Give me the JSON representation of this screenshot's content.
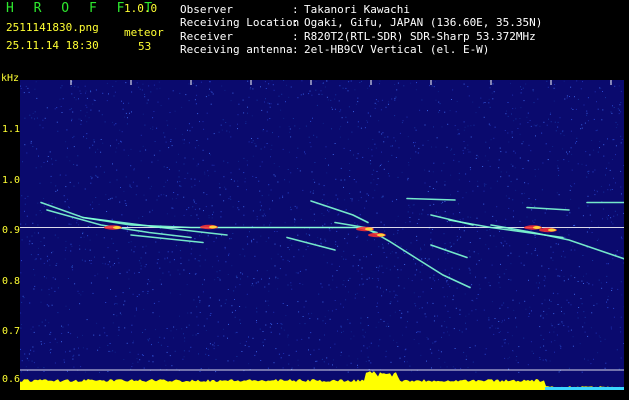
{
  "header": {
    "app_title": "H R O F F T",
    "app_version": "1.0.0",
    "file_name": "2511141830.png",
    "timestamp": "25.11.14 18:30",
    "meteor_label": "meteor",
    "meteor_count": "53",
    "info": [
      {
        "label": "Observer",
        "value": "Takanori Kawachi"
      },
      {
        "label": "Receiving Location",
        "value": "Ogaki, Gifu, JAPAN (136.60E, 35.35N)"
      },
      {
        "label": "Receiver",
        "value": "R820T2(RTL-SDR) SDR-Sharp 53.372MHz"
      },
      {
        "label": "Receiving antenna",
        "value": "2el-HB9CV Vertical (el. E-W)"
      }
    ],
    "separator": ":"
  },
  "colors": {
    "background": "#000000",
    "plot_background": "#0a0a6e",
    "title": "#2ee82e",
    "axis_text": "#ffff33",
    "trail": "#7fffd4",
    "reference_line": "#ffffff",
    "bottom_band": "#ffff00"
  },
  "chart_data": {
    "type": "heatmap",
    "yunit": "kHz",
    "yticks": [
      "1.1",
      "1.0",
      "0.9",
      "0.8",
      "0.7",
      "0.6"
    ],
    "xticks": [
      "1831",
      "1832",
      "1833",
      "1834",
      "1835",
      "1836",
      "1837",
      "1838",
      "1839",
      "1840"
    ],
    "xlim": [
      1830.5,
      1840.5
    ],
    "ylim": [
      0.58,
      1.15
    ],
    "reference_lines": [
      0.905,
      0.62
    ],
    "traces": [
      {
        "x": [
          1830.5,
          1831.2,
          1832.0,
          1833.0,
          1834.0,
          1835.0,
          1835.8,
          1836.1
        ],
        "y": [
          0.955,
          0.925,
          0.91,
          0.905,
          0.905,
          0.905,
          0.905,
          0.895
        ]
      },
      {
        "x": [
          1830.6,
          1831.5,
          1832.3,
          1833.0
        ],
        "y": [
          0.94,
          0.91,
          0.895,
          0.885
        ]
      },
      {
        "x": [
          1831.2,
          1832.5,
          1833.6
        ],
        "y": [
          0.925,
          0.905,
          0.89
        ]
      },
      {
        "x": [
          1832.0,
          1833.2
        ],
        "y": [
          0.89,
          0.875
        ]
      },
      {
        "x": [
          1835.0,
          1835.7,
          1835.95
        ],
        "y": [
          0.958,
          0.93,
          0.915
        ]
      },
      {
        "x": [
          1834.6,
          1835.4
        ],
        "y": [
          0.885,
          0.86
        ]
      },
      {
        "x": [
          1835.4,
          1835.9,
          1836.3,
          1836.8,
          1837.2,
          1837.65
        ],
        "y": [
          0.915,
          0.905,
          0.878,
          0.84,
          0.81,
          0.785
        ]
      },
      {
        "x": [
          1837.0,
          1837.7
        ],
        "y": [
          0.93,
          0.91
        ]
      },
      {
        "x": [
          1837.0,
          1837.6
        ],
        "y": [
          0.87,
          0.845
        ]
      },
      {
        "x": [
          1837.3,
          1838.0,
          1838.6,
          1839.2
        ],
        "y": [
          0.92,
          0.905,
          0.895,
          0.885
        ]
      },
      {
        "x": [
          1838.0,
          1838.7,
          1839.3,
          1840.4
        ],
        "y": [
          0.91,
          0.895,
          0.88,
          0.835
        ]
      },
      {
        "x": [
          1838.6,
          1839.3
        ],
        "y": [
          0.945,
          0.94
        ]
      },
      {
        "x": [
          1839.6,
          1840.4
        ],
        "y": [
          0.955,
          0.955
        ]
      },
      {
        "x": [
          1836.6,
          1837.4
        ],
        "y": [
          0.963,
          0.96
        ]
      }
    ],
    "hotspots": [
      {
        "x": 1833.3,
        "y": 0.906
      },
      {
        "x": 1835.9,
        "y": 0.902
      },
      {
        "x": 1836.1,
        "y": 0.89
      },
      {
        "x": 1838.7,
        "y": 0.905
      },
      {
        "x": 1838.95,
        "y": 0.9
      },
      {
        "x": 1831.7,
        "y": 0.905
      }
    ]
  }
}
